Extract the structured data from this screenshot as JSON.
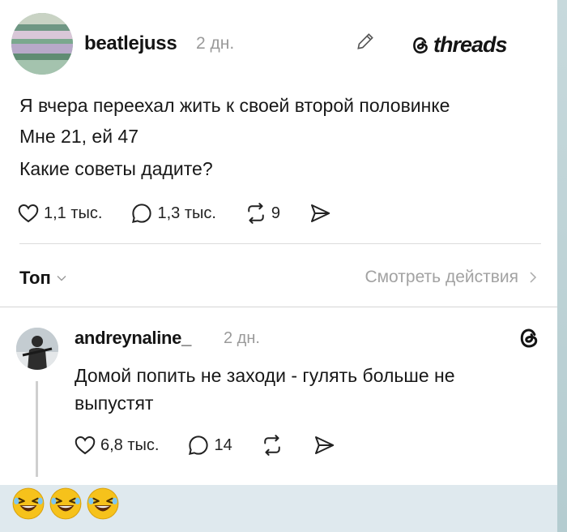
{
  "post": {
    "username": "beatlejuss",
    "time": "2 дн.",
    "brand": "threads",
    "lines": [
      "Я вчера переехал жить к своей второй половинке",
      "Мне 21, ей 47",
      "Какие советы дадите?"
    ],
    "likes": "1,1 тыс.",
    "comments": "1,3 тыс.",
    "reposts": "9"
  },
  "sort": {
    "label": "Топ",
    "view_activity": "Смотреть действия"
  },
  "reply": {
    "username": "andreynaline_",
    "time": "2 дн.",
    "lines": [
      "Домой попить не заходи - гулять больше не",
      "выпустят"
    ],
    "likes": "6,8 тыс.",
    "comments": "14"
  },
  "emoji": [
    "laughing-face",
    "laughing-face",
    "laughing-face"
  ],
  "colors": {
    "background": "#dfe9ee",
    "card": "#ffffff",
    "muted_text": "#9a9a9a",
    "emoji_yellow": "#f6c21b"
  }
}
